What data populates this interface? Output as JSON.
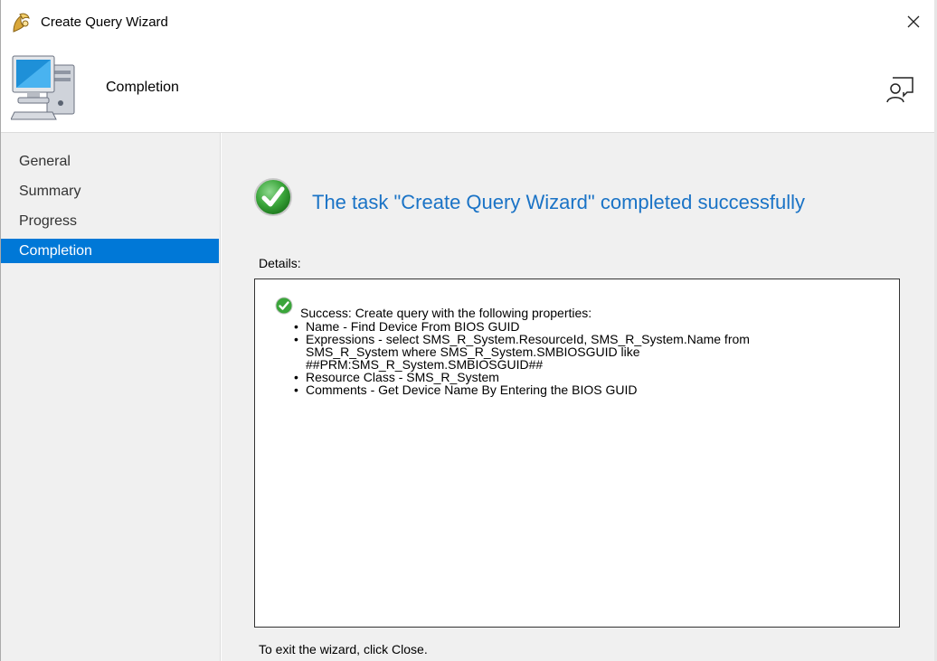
{
  "window": {
    "title": "Create Query Wizard",
    "close_glyph": "✕"
  },
  "header": {
    "title": "Completion",
    "icon": "computer-icon",
    "help_icon": "feedback-smiley-icon"
  },
  "sidebar": {
    "items": [
      {
        "label": "General",
        "active": false
      },
      {
        "label": "Summary",
        "active": false
      },
      {
        "label": "Progress",
        "active": false
      },
      {
        "label": "Completion",
        "active": true
      }
    ]
  },
  "main": {
    "status_message": "The task \"Create Query Wizard\" completed successfully",
    "details_label": "Details:",
    "details": {
      "heading": "Success: Create query with the following properties:",
      "items": [
        "Name - Find Device From BIOS GUID",
        "Expressions - select SMS_R_System.ResourceId, SMS_R_System.Name from SMS_R_System where SMS_R_System.SMBIOSGUID like ##PRM:SMS_R_System.SMBIOSGUID##",
        "Resource Class - SMS_R_System",
        "Comments - Get Device Name By Entering the BIOS GUID"
      ]
    },
    "footer": "To exit the wizard, click Close."
  },
  "colors": {
    "accent": "#0078d7",
    "status_text": "#1a73c6",
    "success_green": "#3aa53a",
    "panel_bg": "#f0f0f0"
  }
}
